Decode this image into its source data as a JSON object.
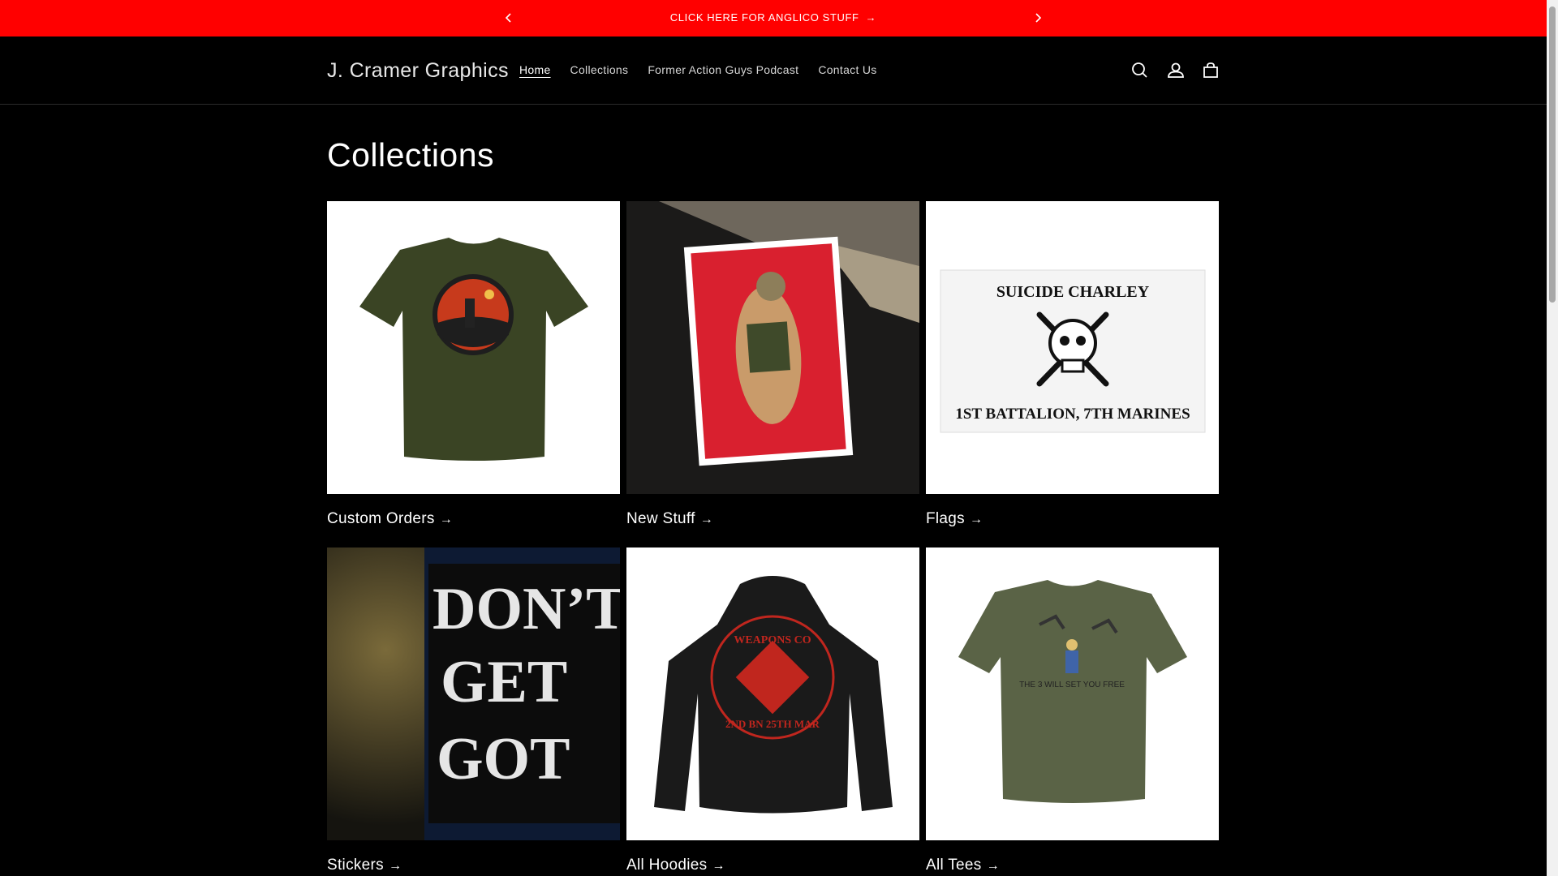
{
  "announcement": {
    "text": "CLICK HERE FOR ANGLICO STUFF",
    "arrow": "→",
    "prev_icon": "chevron-left-icon",
    "next_icon": "chevron-right-icon"
  },
  "header": {
    "logo": "J. Cramer Graphics",
    "nav": [
      {
        "label": "Home",
        "active": true
      },
      {
        "label": "Collections",
        "active": false
      },
      {
        "label": "Former Action Guys Podcast",
        "active": false
      },
      {
        "label": "Contact Us",
        "active": false
      }
    ],
    "icons": [
      "search-icon",
      "account-icon",
      "cart-icon"
    ]
  },
  "main": {
    "title": "Collections",
    "collections": [
      {
        "label": "Custom Orders"
      },
      {
        "label": "New Stuff"
      },
      {
        "label": "Flags"
      },
      {
        "label": "Stickers"
      },
      {
        "label": "All Hoodies"
      },
      {
        "label": "All Tees"
      }
    ],
    "artwork_text": {
      "flag_top": "SUICIDE CHARLEY",
      "flag_bottom": "1ST BATTALION, 7TH MARINES",
      "sticker_lines": [
        "DON’T",
        "GET",
        "GOT"
      ],
      "hoodie_top": "WEAPONS CO",
      "hoodie_bottom": "2ND BN 25TH MAR",
      "tee_text": "THE 3 WILL SET YOU FREE"
    },
    "arrow": "→"
  },
  "colors": {
    "announcement_bg": "#ff0000",
    "page_bg": "#000000",
    "text": "#ffffff"
  }
}
